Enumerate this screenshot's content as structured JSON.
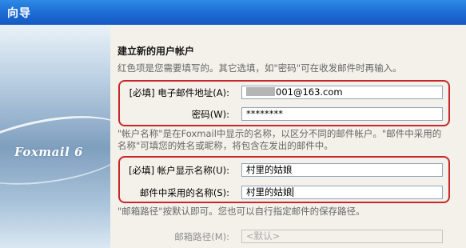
{
  "window": {
    "title": "向导"
  },
  "sidebar": {
    "brand": "Foxmail 6"
  },
  "section": {
    "title": "建立新的用户帐户",
    "instruction": "红色项是您需要填写的。其它选填，如\"密码\"可在收发邮件时再输入。",
    "account_note_line1": "\"帐户名称\"是在Foxmail中显示的名称，以区分不同的邮件帐户。\"邮件中采用的",
    "account_note_line2": "名称\"可填您的姓名或昵称，将包含在发出的邮件中。",
    "path_note": "\"邮箱路径\"按默认即可。您也可以自行指定邮件的保存路径。"
  },
  "form": {
    "email_label": "[必填] 电子邮件地址(A):",
    "email_value": "001@163.com",
    "password_label": "密码(W):",
    "password_value": "********",
    "display_name_label": "[必填] 帐户显示名称(U):",
    "display_name_value": "村里的姑娘",
    "sender_name_label": "邮件中采用的名称(S):",
    "sender_name_value": "村里的姑娘",
    "path_label": "邮箱路径(M):",
    "path_placeholder": "<默认>"
  },
  "colors": {
    "highlight": "#c8282a",
    "titlebar": "#1f6fd6"
  }
}
